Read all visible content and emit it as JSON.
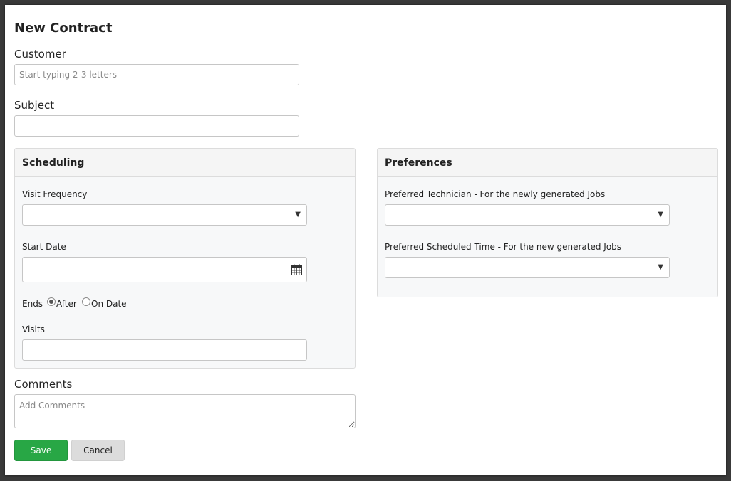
{
  "page": {
    "title": "New Contract"
  },
  "customer": {
    "label": "Customer",
    "placeholder": "Start typing 2-3 letters",
    "value": ""
  },
  "subject": {
    "label": "Subject",
    "value": ""
  },
  "scheduling": {
    "title": "Scheduling",
    "visit_frequency": {
      "label": "Visit Frequency",
      "value": ""
    },
    "start_date": {
      "label": "Start Date",
      "value": ""
    },
    "ends": {
      "label": "Ends",
      "options": [
        "After",
        "On Date"
      ],
      "selected": "After"
    },
    "visits": {
      "label": "Visits",
      "value": ""
    }
  },
  "preferences": {
    "title": "Preferences",
    "preferred_technician": {
      "label": "Preferred Technician - For the newly generated Jobs",
      "value": ""
    },
    "preferred_time": {
      "label": "Preferred Scheduled Time - For the new generated Jobs",
      "value": ""
    }
  },
  "comments": {
    "label": "Comments",
    "placeholder": "Add Comments"
  },
  "actions": {
    "save_label": "Save",
    "cancel_label": "Cancel"
  },
  "colors": {
    "save_bg": "#28a745",
    "cancel_bg": "#dcdcdc",
    "panel_bg": "#f7f8f9"
  },
  "icons": {
    "dropdown": "caret-down-icon",
    "date": "calendar-icon"
  }
}
